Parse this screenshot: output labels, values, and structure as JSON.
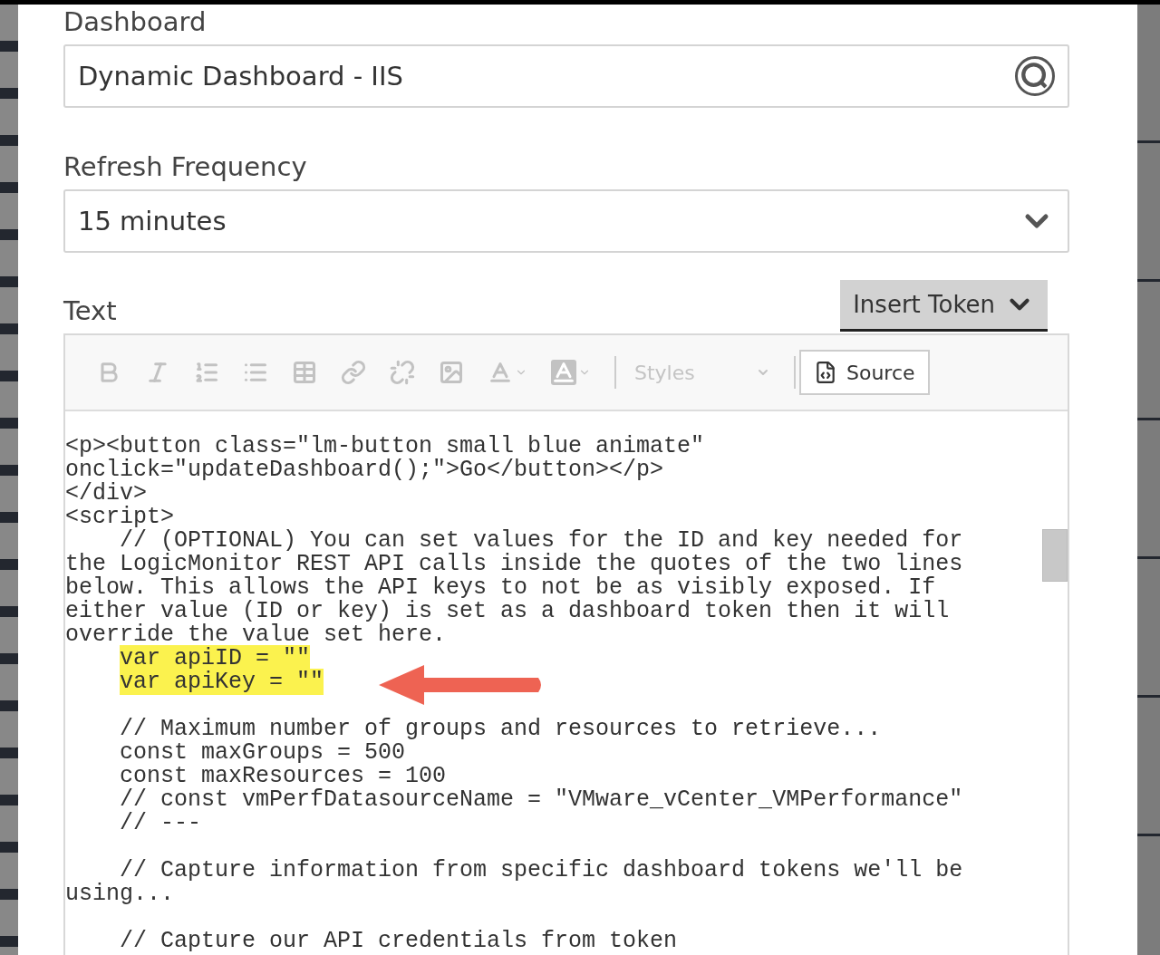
{
  "dashboard_field": {
    "label": "Dashboard",
    "value": "Dynamic Dashboard - IIS"
  },
  "refresh_field": {
    "label": "Refresh Frequency",
    "value": "15 minutes"
  },
  "text_field": {
    "label": "Text",
    "insert_token_button": "Insert Token",
    "toolbar": {
      "styles_placeholder": "Styles",
      "source_button": "Source"
    },
    "code_lines": [
      {
        "kind": "code",
        "text": "<p><button class=\"lm-button small blue animate\"",
        "highlighted": false
      },
      {
        "kind": "code",
        "text": "onclick=\"updateDashboard();\">Go</button></p>",
        "highlighted": false
      },
      {
        "kind": "code",
        "text": "</div>",
        "highlighted": false
      },
      {
        "kind": "code",
        "text": "<script>",
        "highlighted": false
      },
      {
        "kind": "code",
        "text": "    // (OPTIONAL) You can set values for the ID and key needed for",
        "highlighted": false
      },
      {
        "kind": "code",
        "text": "the LogicMonitor REST API calls inside the quotes of the two lines",
        "highlighted": false
      },
      {
        "kind": "code",
        "text": "below. This allows the API keys to not be as visibly exposed. If",
        "highlighted": false
      },
      {
        "kind": "code",
        "text": "either value (ID or key) is set as a dashboard token then it will",
        "highlighted": false
      },
      {
        "kind": "code",
        "text": "override the value set here.",
        "highlighted": false
      },
      {
        "kind": "code",
        "text": "    var apiID = \"\"",
        "highlighted": true
      },
      {
        "kind": "code",
        "text": "    var apiKey = \"\"",
        "highlighted": true
      },
      {
        "kind": "blank"
      },
      {
        "kind": "code",
        "text": "    // Maximum number of groups and resources to retrieve...",
        "highlighted": false
      },
      {
        "kind": "code",
        "text": "    const maxGroups = 500",
        "highlighted": false
      },
      {
        "kind": "code",
        "text": "    const maxResources = 100",
        "highlighted": false
      },
      {
        "kind": "code",
        "text": "    // const vmPerfDatasourceName = \"VMware_vCenter_VMPerformance\"",
        "highlighted": false
      },
      {
        "kind": "code",
        "text": "    // ---",
        "highlighted": false
      },
      {
        "kind": "blank"
      },
      {
        "kind": "code",
        "text": "    // Capture information from specific dashboard tokens we'll be",
        "highlighted": false
      },
      {
        "kind": "code",
        "text": "using...",
        "highlighted": false
      },
      {
        "kind": "blank"
      },
      {
        "kind": "code",
        "text": "    // Capture our API credentials from token",
        "highlighted": false
      }
    ]
  }
}
